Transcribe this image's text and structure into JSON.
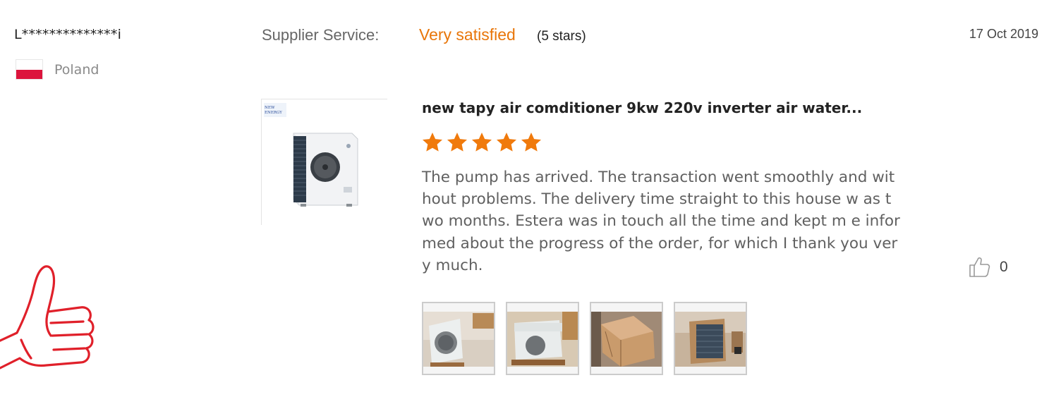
{
  "reviewer": {
    "name": "L**************i",
    "country": "Poland",
    "flag_colors": [
      "#ffffff",
      "#dc143c"
    ]
  },
  "supplier_service": {
    "label": "Supplier Service:",
    "value": "Very satisfied",
    "stars_text": "(5 stars)"
  },
  "date": "17 Oct 2019",
  "product": {
    "title": "new tapy air comditioner 9kw 220v inverter air water...",
    "image_logo_text": "NEW ENERGY",
    "rating": 5,
    "rating_max": 5
  },
  "review_text": "The pump has arrived. The transaction went smoothly and without problems. The delivery time straight to this house w as two months. Estera was in touch all the time and kept m e informed about the progress of the order, for which I thank you very much.",
  "like": {
    "icon": "thumbs-up-outline-icon",
    "count": "0"
  },
  "photos": [
    {
      "name": "review-photo-1"
    },
    {
      "name": "review-photo-2"
    },
    {
      "name": "review-photo-3"
    },
    {
      "name": "review-photo-4"
    }
  ],
  "colors": {
    "accent": "#e8760a",
    "star": "#f07a0c",
    "thumb_decor": "#e0202a"
  }
}
